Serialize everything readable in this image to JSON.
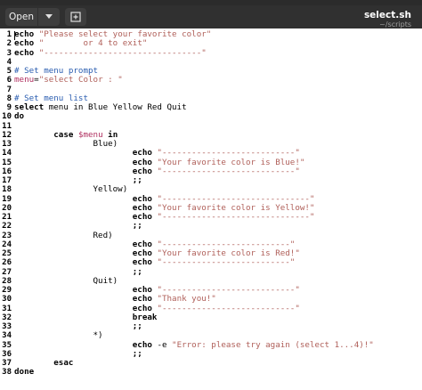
{
  "window": {
    "title": "select.sh",
    "subtitle": "~/scripts",
    "open_label": "Open",
    "open_arrow_icon": "chevron-down-icon",
    "new_tab_icon": "new-document-icon"
  },
  "colors": {
    "header_bg": "#303030",
    "string": "#b0605a",
    "comment": "#2a5db0",
    "variable": "#b03060"
  },
  "lines": [
    {
      "n": "1",
      "tokens": [
        {
          "t": "kw",
          "v": "echo"
        },
        {
          "t": "p",
          "v": " "
        },
        {
          "t": "str",
          "v": "\"Please select your favorite color\""
        }
      ]
    },
    {
      "n": "2",
      "tokens": [
        {
          "t": "kw",
          "v": "echo"
        },
        {
          "t": "p",
          "v": " "
        },
        {
          "t": "str",
          "v": "\"        or 4 to exit\""
        }
      ]
    },
    {
      "n": "3",
      "tokens": [
        {
          "t": "kw",
          "v": "echo"
        },
        {
          "t": "p",
          "v": " "
        },
        {
          "t": "str",
          "v": "\"--------------------------------\""
        }
      ]
    },
    {
      "n": "4",
      "tokens": []
    },
    {
      "n": "5",
      "tokens": [
        {
          "t": "cm",
          "v": "# Set menu prompt"
        }
      ]
    },
    {
      "n": "6",
      "tokens": [
        {
          "t": "var",
          "v": "menu"
        },
        {
          "t": "p",
          "v": "="
        },
        {
          "t": "str",
          "v": "\"select Color : \""
        }
      ]
    },
    {
      "n": "7",
      "tokens": []
    },
    {
      "n": "8",
      "tokens": [
        {
          "t": "cm",
          "v": "# Set menu list"
        }
      ]
    },
    {
      "n": "9",
      "tokens": [
        {
          "t": "kw",
          "v": "select"
        },
        {
          "t": "p",
          "v": " menu in Blue Yellow Red Quit"
        }
      ]
    },
    {
      "n": "10",
      "tokens": [
        {
          "t": "kw",
          "v": "do"
        }
      ]
    },
    {
      "n": "11",
      "tokens": []
    },
    {
      "n": "12",
      "tokens": [
        {
          "t": "p",
          "v": "        "
        },
        {
          "t": "kw",
          "v": "case"
        },
        {
          "t": "p",
          "v": " "
        },
        {
          "t": "var",
          "v": "$menu"
        },
        {
          "t": "p",
          "v": " "
        },
        {
          "t": "kw",
          "v": "in"
        }
      ]
    },
    {
      "n": "13",
      "tokens": [
        {
          "t": "p",
          "v": "                Blue)"
        }
      ]
    },
    {
      "n": "14",
      "tokens": [
        {
          "t": "p",
          "v": "                        "
        },
        {
          "t": "kw",
          "v": "echo"
        },
        {
          "t": "p",
          "v": " "
        },
        {
          "t": "str",
          "v": "\"---------------------------\""
        }
      ]
    },
    {
      "n": "15",
      "tokens": [
        {
          "t": "p",
          "v": "                        "
        },
        {
          "t": "kw",
          "v": "echo"
        },
        {
          "t": "p",
          "v": " "
        },
        {
          "t": "str",
          "v": "\"Your favorite color is Blue!\""
        }
      ]
    },
    {
      "n": "16",
      "tokens": [
        {
          "t": "p",
          "v": "                        "
        },
        {
          "t": "kw",
          "v": "echo"
        },
        {
          "t": "p",
          "v": " "
        },
        {
          "t": "str",
          "v": "\"---------------------------\""
        }
      ]
    },
    {
      "n": "17",
      "tokens": [
        {
          "t": "p",
          "v": "                        "
        },
        {
          "t": "kw",
          "v": ";;"
        }
      ]
    },
    {
      "n": "18",
      "tokens": [
        {
          "t": "p",
          "v": "                Yellow)"
        }
      ]
    },
    {
      "n": "19",
      "tokens": [
        {
          "t": "p",
          "v": "                        "
        },
        {
          "t": "kw",
          "v": "echo"
        },
        {
          "t": "p",
          "v": " "
        },
        {
          "t": "str",
          "v": "\"------------------------------\""
        }
      ]
    },
    {
      "n": "20",
      "tokens": [
        {
          "t": "p",
          "v": "                        "
        },
        {
          "t": "kw",
          "v": "echo"
        },
        {
          "t": "p",
          "v": " "
        },
        {
          "t": "str",
          "v": "\"Your favorite color is Yellow!\""
        }
      ]
    },
    {
      "n": "21",
      "tokens": [
        {
          "t": "p",
          "v": "                        "
        },
        {
          "t": "kw",
          "v": "echo"
        },
        {
          "t": "p",
          "v": " "
        },
        {
          "t": "str",
          "v": "\"------------------------------\""
        }
      ]
    },
    {
      "n": "22",
      "tokens": [
        {
          "t": "p",
          "v": "                        "
        },
        {
          "t": "kw",
          "v": ";;"
        }
      ]
    },
    {
      "n": "23",
      "tokens": [
        {
          "t": "p",
          "v": "                Red)"
        }
      ]
    },
    {
      "n": "24",
      "tokens": [
        {
          "t": "p",
          "v": "                        "
        },
        {
          "t": "kw",
          "v": "echo"
        },
        {
          "t": "p",
          "v": " "
        },
        {
          "t": "str",
          "v": "\"--------------------------\""
        }
      ]
    },
    {
      "n": "25",
      "tokens": [
        {
          "t": "p",
          "v": "                        "
        },
        {
          "t": "kw",
          "v": "echo"
        },
        {
          "t": "p",
          "v": " "
        },
        {
          "t": "str",
          "v": "\"Your favorite color is Red!\""
        }
      ]
    },
    {
      "n": "26",
      "tokens": [
        {
          "t": "p",
          "v": "                        "
        },
        {
          "t": "kw",
          "v": "echo"
        },
        {
          "t": "p",
          "v": " "
        },
        {
          "t": "str",
          "v": "\"--------------------------\""
        }
      ]
    },
    {
      "n": "27",
      "tokens": [
        {
          "t": "p",
          "v": "                        "
        },
        {
          "t": "kw",
          "v": ";;"
        }
      ]
    },
    {
      "n": "28",
      "tokens": [
        {
          "t": "p",
          "v": "                Quit)"
        }
      ]
    },
    {
      "n": "29",
      "tokens": [
        {
          "t": "p",
          "v": "                        "
        },
        {
          "t": "kw",
          "v": "echo"
        },
        {
          "t": "p",
          "v": " "
        },
        {
          "t": "str",
          "v": "\"---------------------------\""
        }
      ]
    },
    {
      "n": "30",
      "tokens": [
        {
          "t": "p",
          "v": "                        "
        },
        {
          "t": "kw",
          "v": "echo"
        },
        {
          "t": "p",
          "v": " "
        },
        {
          "t": "str",
          "v": "\"Thank you!\""
        }
      ]
    },
    {
      "n": "31",
      "tokens": [
        {
          "t": "p",
          "v": "                        "
        },
        {
          "t": "kw",
          "v": "echo"
        },
        {
          "t": "p",
          "v": " "
        },
        {
          "t": "str",
          "v": "\"---------------------------\""
        }
      ]
    },
    {
      "n": "32",
      "tokens": [
        {
          "t": "p",
          "v": "                        "
        },
        {
          "t": "kw",
          "v": "break"
        }
      ]
    },
    {
      "n": "33",
      "tokens": [
        {
          "t": "p",
          "v": "                        "
        },
        {
          "t": "kw",
          "v": ";;"
        }
      ]
    },
    {
      "n": "34",
      "tokens": [
        {
          "t": "p",
          "v": "                *)"
        }
      ]
    },
    {
      "n": "35",
      "tokens": [
        {
          "t": "p",
          "v": "                        "
        },
        {
          "t": "kw",
          "v": "echo"
        },
        {
          "t": "p",
          "v": " -e "
        },
        {
          "t": "str",
          "v": "\"Error: please try again (select 1...4)!\""
        }
      ]
    },
    {
      "n": "36",
      "tokens": [
        {
          "t": "p",
          "v": "                        "
        },
        {
          "t": "kw",
          "v": ";;"
        }
      ]
    },
    {
      "n": "37",
      "tokens": [
        {
          "t": "p",
          "v": "        "
        },
        {
          "t": "kw",
          "v": "esac"
        }
      ]
    },
    {
      "n": "38",
      "tokens": [
        {
          "t": "kw",
          "v": "done"
        }
      ]
    }
  ]
}
